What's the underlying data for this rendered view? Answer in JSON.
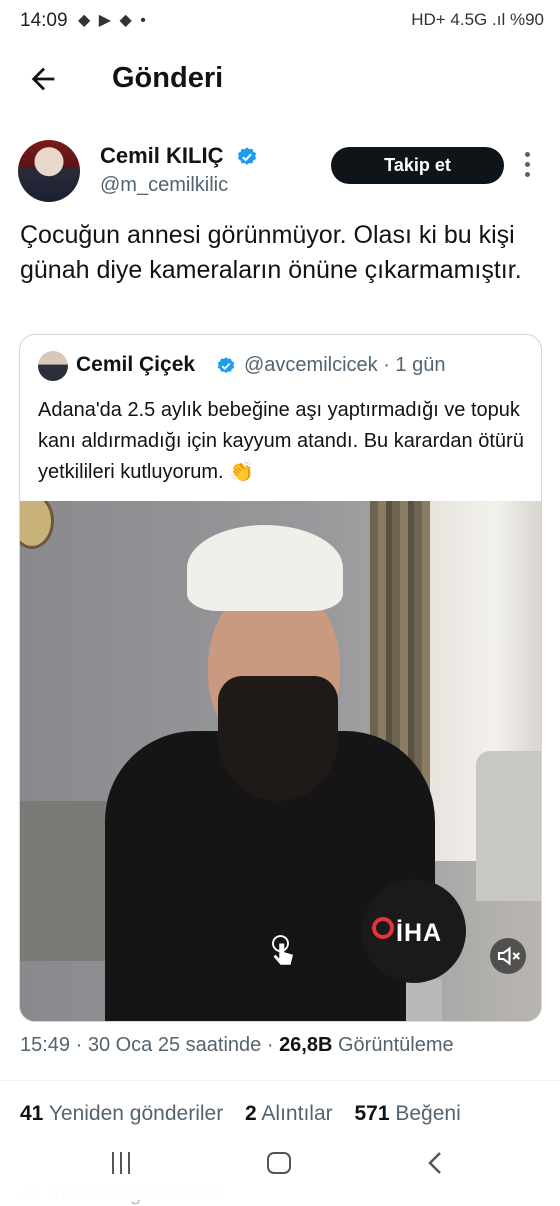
{
  "status_bar": {
    "time": "14:09",
    "left_icons": [
      "layers-icon",
      "youtube-icon",
      "layers-icon",
      "dot-icon"
    ],
    "network": "HD+ 4.5G",
    "battery": "%90"
  },
  "header": {
    "title": "Gönderi"
  },
  "author": {
    "name": "Cemil KILIÇ",
    "handle": "@m_cemilkilic",
    "follow_label": "Takip et"
  },
  "tweet": {
    "text": "Çocuğun annesi görünmüyor. Olası ki bu kişi günah diye kameraların önüne çıkarmamıştır."
  },
  "quote": {
    "name": "Cemil Çiçek",
    "handle_time": "@avcemilcicek · 1 gün",
    "text": "Adana'da 2.5 aylık bebeğine aşı yaptırmadığı ve topuk kanı aldırmadığı için kayyum atandı. Bu karardan ötürü yetkilileri kutluyorum. 👏",
    "media_logo": "İHA"
  },
  "meta": {
    "time_date": "15:49 · 30 Oca 25 saatinde · ",
    "views_count": "26,8B",
    "views_label": " Görüntüleme"
  },
  "stats": {
    "reposts_count": "41",
    "reposts_label": "Yeniden gönderiler",
    "quotes_count": "2",
    "quotes_label": "Alıntılar",
    "likes_count": "571",
    "likes_label": "Beğeni"
  },
  "colors": {
    "verified": "#1d9bf0",
    "text_primary": "#0f1419",
    "text_secondary": "#536471",
    "follow_bg": "#0f1419"
  }
}
